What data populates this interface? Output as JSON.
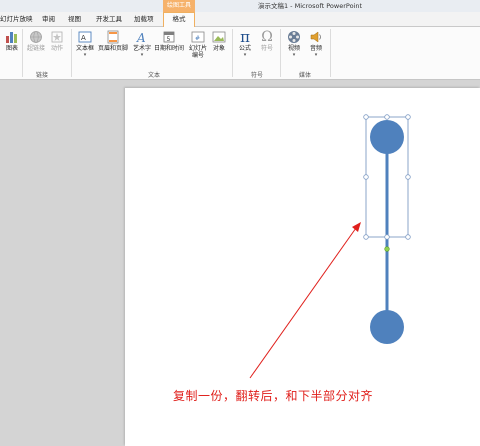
{
  "window": {
    "title": "演示文稿1 - Microsoft PowerPoint"
  },
  "tabs": [
    {
      "label": "幻灯片放映"
    },
    {
      "label": "审阅"
    },
    {
      "label": "视图"
    },
    {
      "label": "开发工具"
    },
    {
      "label": "加载项"
    }
  ],
  "context_tab": {
    "group_label": "绘图工具",
    "tab_label": "格式"
  },
  "ribbon": {
    "groups": {
      "links": "链接",
      "text": "文本",
      "symbols": "符号",
      "media": "媒体"
    },
    "buttons": {
      "chart": "图表",
      "hyperlink": "超链接",
      "action": "动作",
      "textbox": "文本框",
      "header_footer": "页眉和页脚",
      "wordart": "艺术字",
      "date_time": "日期和时间",
      "slide_number_1": "幻灯片",
      "slide_number_2": "编号",
      "object": "对象",
      "equation": "公式",
      "symbol": "符号",
      "video": "视频",
      "audio": "音频"
    }
  },
  "slide": {
    "annotation": "复制一份，翻转后，和下半部分对齐",
    "shape_color": "#4f81bd",
    "annotation_color": "#e0201c",
    "selection_color": "#7f9cc4"
  }
}
